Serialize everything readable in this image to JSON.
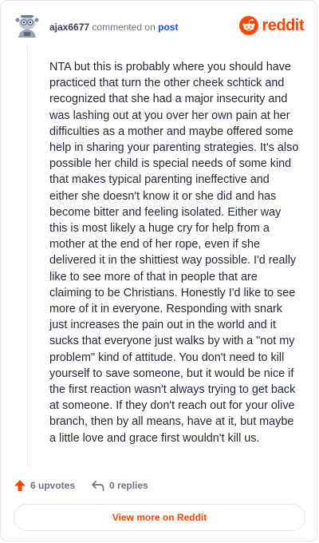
{
  "comment": {
    "author": "ajax6677",
    "action_text": "commented on",
    "target_link": "post",
    "body": "NTA but this is probably where you should have practiced that turn the other cheek schtick and recognized that she had a major insecurity and was lashing out at you over her own pain at her difficulties as a mother and maybe offered some help in sharing your parenting strategies. It's also possible her child is special needs of some kind that makes typical parenting ineffective and either she doesn't know it or she did and has become bitter and feeling isolated. Either way this is most likely a huge cry for help from a mother at the end of her rope, even if she delivered it in the shittiest way possible. I'd really like to see more of that in people that are claiming to be Christians. Honestly I'd like to see more of it in everyone. Responding with snark just increases the pain out in the world and it sucks that everyone just walks by with a \"not my problem\" kind of attitude. You don't need to kill yourself to save someone, but it would be nice if the first reaction wasn't always trying to get back at someone. If they don't reach out for your olive branch, then by all means, have at it, but maybe a little love and grace first wouldn't kill us."
  },
  "brand": {
    "wordmark": "reddit",
    "icon": "reddit-snoo-icon",
    "color": "#ff4500"
  },
  "stats": {
    "upvotes": "6 upvotes",
    "replies": "0 replies",
    "upvote_icon": "upvote-arrow-icon",
    "reply_icon": "reply-arrow-icon"
  },
  "actions": {
    "view_more": "View more on Reddit"
  }
}
